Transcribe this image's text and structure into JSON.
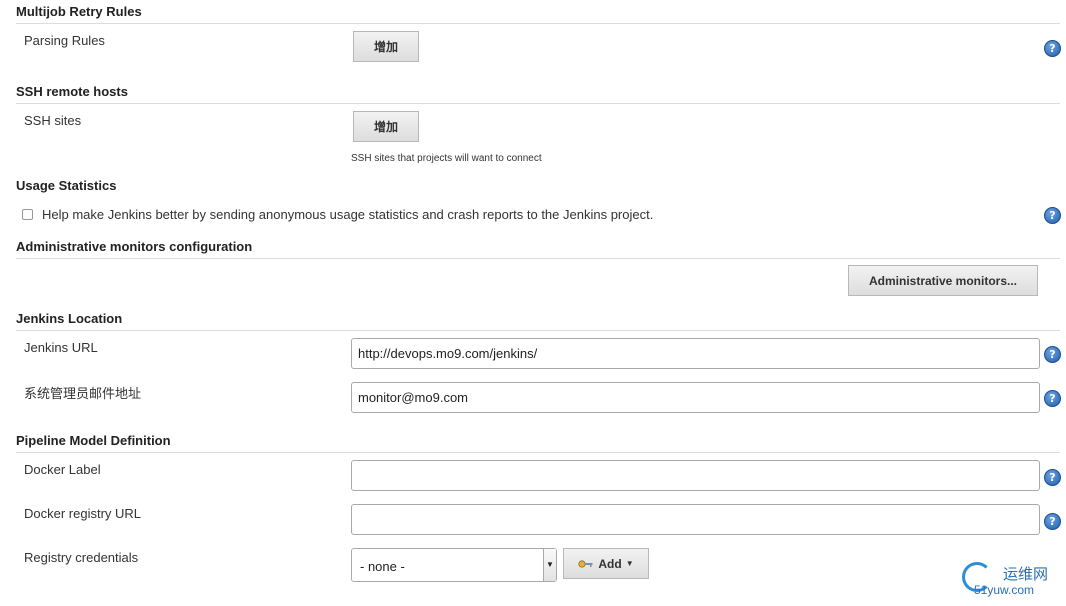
{
  "sections": {
    "multijob": {
      "title": "Multijob Retry Rules",
      "parsing_rules_label": "Parsing Rules",
      "add_button": "增加"
    },
    "ssh": {
      "title": "SSH remote hosts",
      "sites_label": "SSH sites",
      "add_button": "增加",
      "hint": "SSH sites that projects will want to connect"
    },
    "usage": {
      "title": "Usage Statistics",
      "checkbox_label": "Help make Jenkins better by sending anonymous usage statistics and crash reports to the Jenkins project."
    },
    "admin": {
      "title": "Administrative monitors configuration",
      "button": "Administrative monitors..."
    },
    "location": {
      "title": "Jenkins Location",
      "url_label": "Jenkins URL",
      "url_value": "http://devops.mo9.com/jenkins/",
      "email_label": "系统管理员邮件地址",
      "email_value": "monitor@mo9.com"
    },
    "pipeline": {
      "title": "Pipeline Model Definition",
      "docker_label": "Docker Label",
      "docker_label_value": "",
      "registry_url_label": "Docker registry URL",
      "registry_url_value": "",
      "credentials_label": "Registry credentials",
      "credentials_selected": "- none -",
      "add_button": "Add"
    }
  },
  "help_glyph": "?",
  "watermark": {
    "text": "运维网",
    "subtext": "51yuw.com"
  },
  "colors": {
    "help_blue": "#1d5fae",
    "divider": "#dcdcdc"
  }
}
